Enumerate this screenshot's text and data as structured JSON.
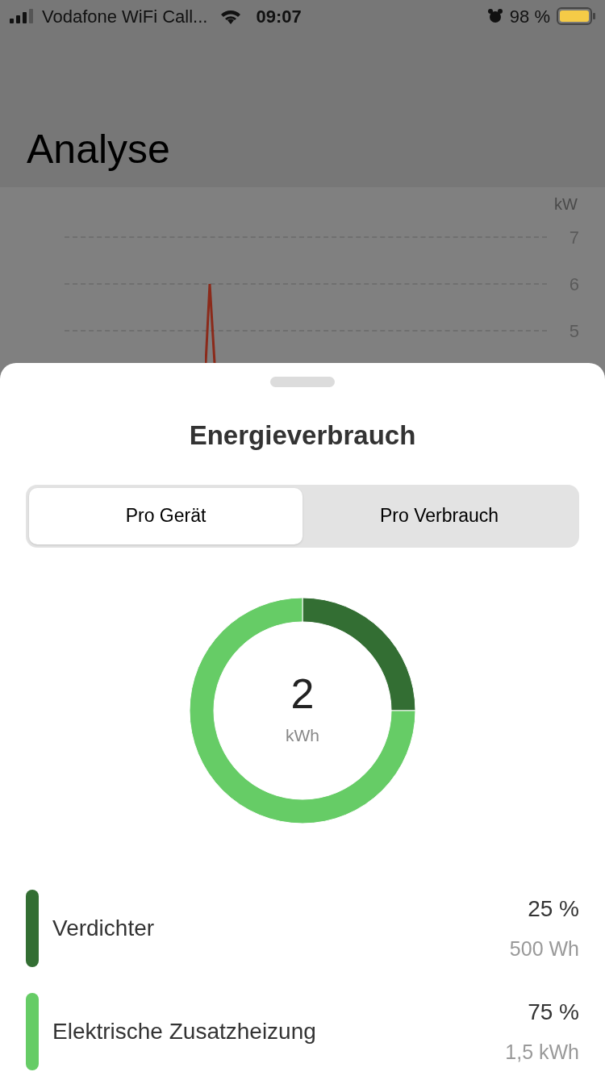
{
  "status_bar": {
    "carrier": "Vodafone WiFi Call...",
    "time": "09:07",
    "battery": "98 %"
  },
  "header": {
    "title": "Analyse"
  },
  "background_chart": {
    "unit": "kW",
    "y_labels": [
      "7",
      "6",
      "5"
    ]
  },
  "sheet": {
    "title": "Energieverbrauch",
    "tabs": [
      {
        "label": "Pro Gerät",
        "selected": true
      },
      {
        "label": "Pro Verbrauch",
        "selected": false
      }
    ],
    "total": {
      "value": "2",
      "unit": "kWh"
    },
    "chart_data": {
      "type": "donut",
      "categories": [
        "Verdichter",
        "Elektrische Zusatzheizung"
      ],
      "values": [
        25,
        75
      ]
    },
    "items": [
      {
        "percent": "25 %",
        "amount": "500 Wh",
        "color": "#336e33"
      },
      {
        "percent": "75 %",
        "amount": "1,5 kWh",
        "color": "#66cc66"
      }
    ]
  }
}
